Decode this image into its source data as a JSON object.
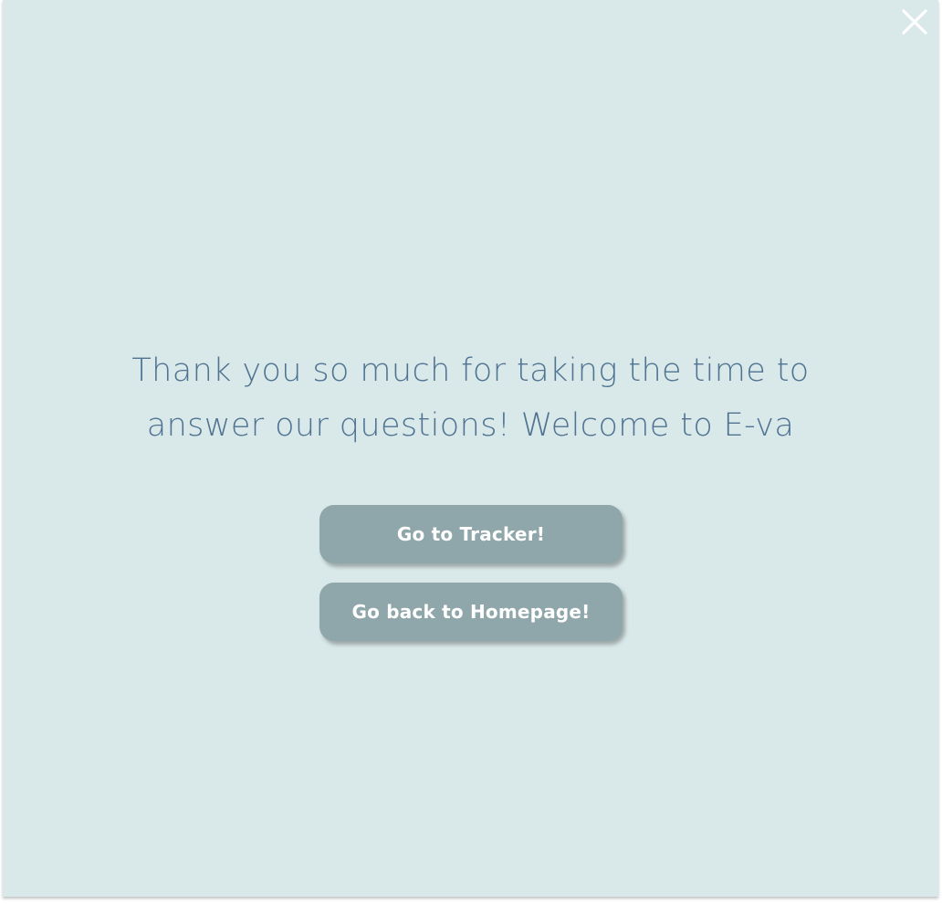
{
  "modal": {
    "close_icon": "close-icon",
    "message_line1": "Thank you so much for taking the time to",
    "message_line2": "answer our questions! Welcome to E-va",
    "buttons": {
      "tracker_label": "Go to Tracker!",
      "homepage_label": "Go back to Homepage!"
    }
  },
  "colors": {
    "background": "#d9e8e9",
    "text": "#4f7391",
    "button": "#8fa7aa",
    "button_text": "#ffffff"
  }
}
